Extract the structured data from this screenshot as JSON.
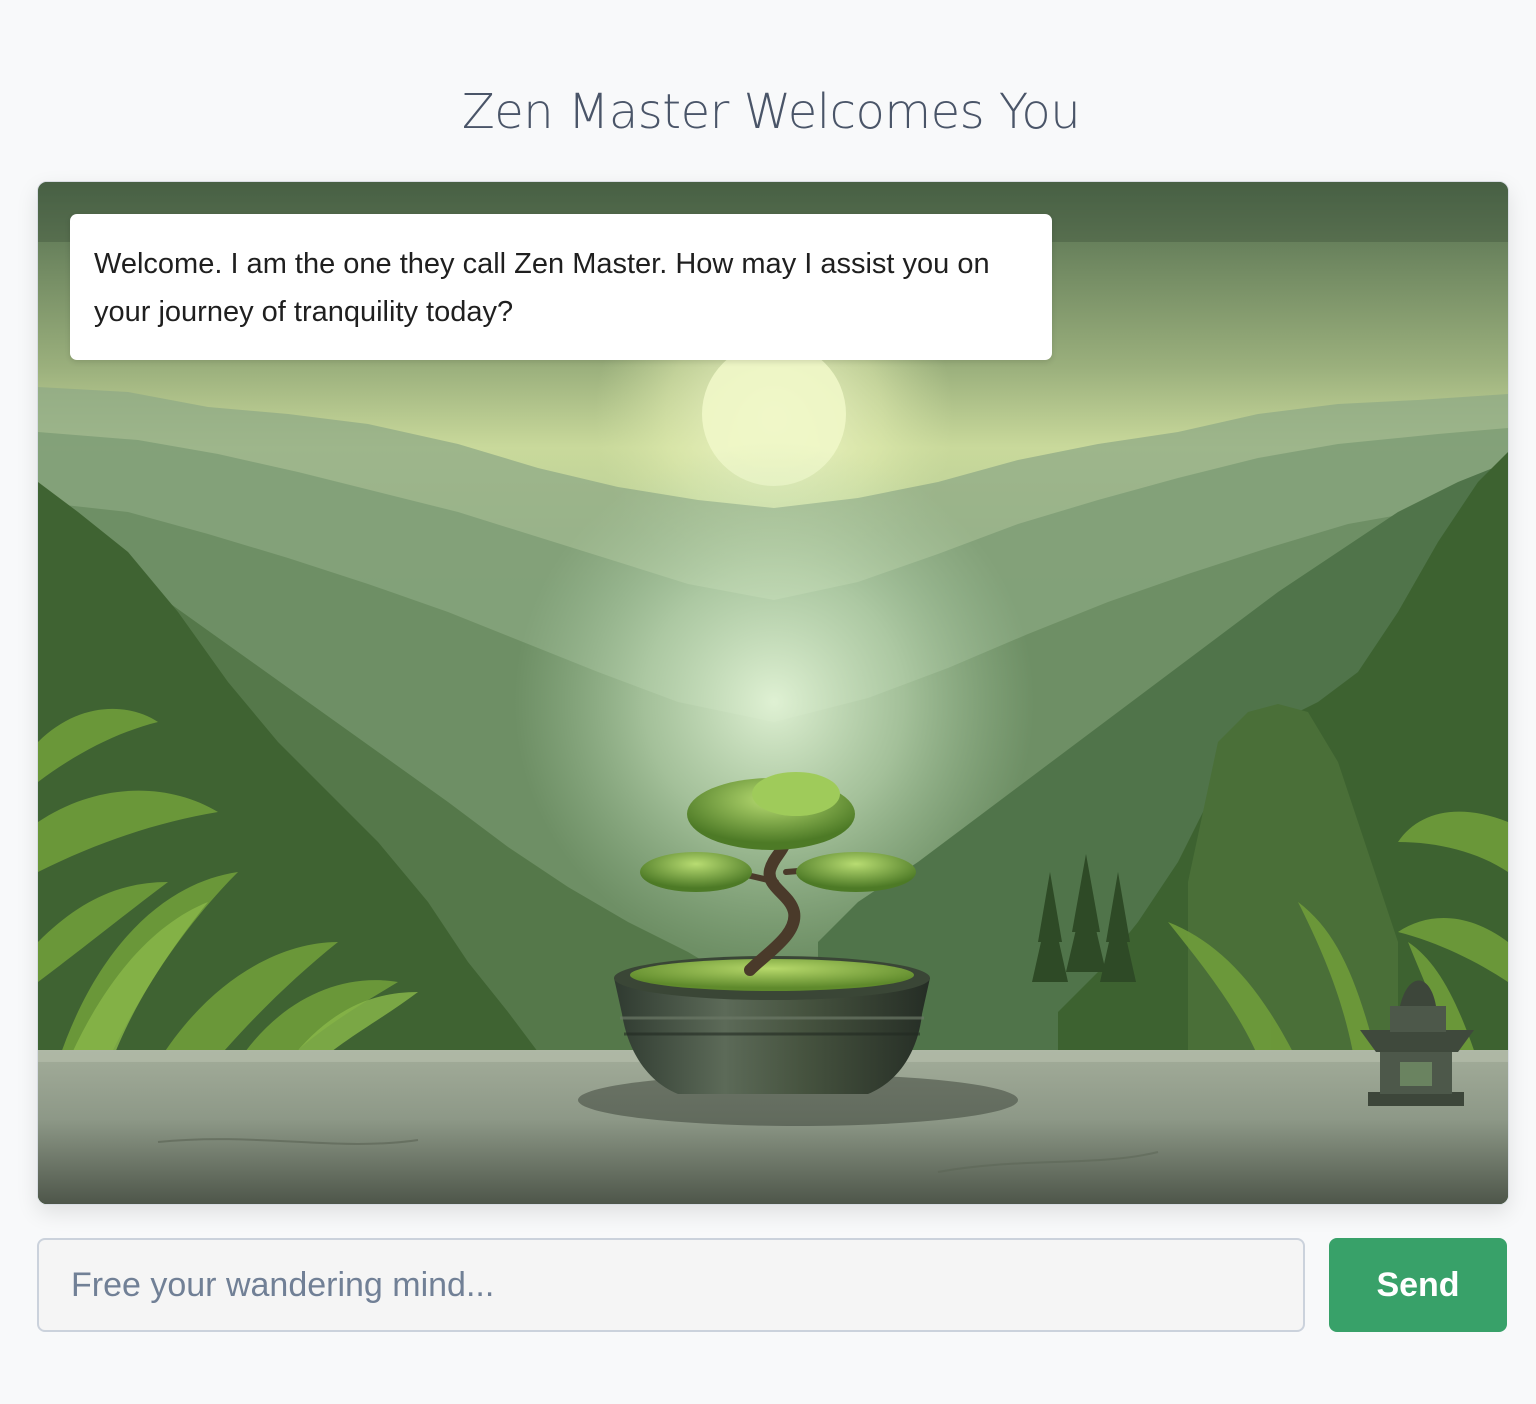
{
  "header": {
    "title": "Zen Master Welcomes You"
  },
  "chat": {
    "messages": [
      {
        "sender": "zen-master",
        "text": "Welcome. I am the one they call Zen Master. How may I assist you on your journey of tranquility today?"
      }
    ],
    "background_scene": "misty green mountain valley with a bonsai tree in a stone bowl and a small stone lantern"
  },
  "composer": {
    "placeholder": "Free your wandering mind...",
    "value": "",
    "send_label": "Send"
  },
  "colors": {
    "page_background": "#f8f9fa",
    "title_text": "#4a5568",
    "send_button": "#38a169",
    "input_border": "#cbd2dc"
  }
}
